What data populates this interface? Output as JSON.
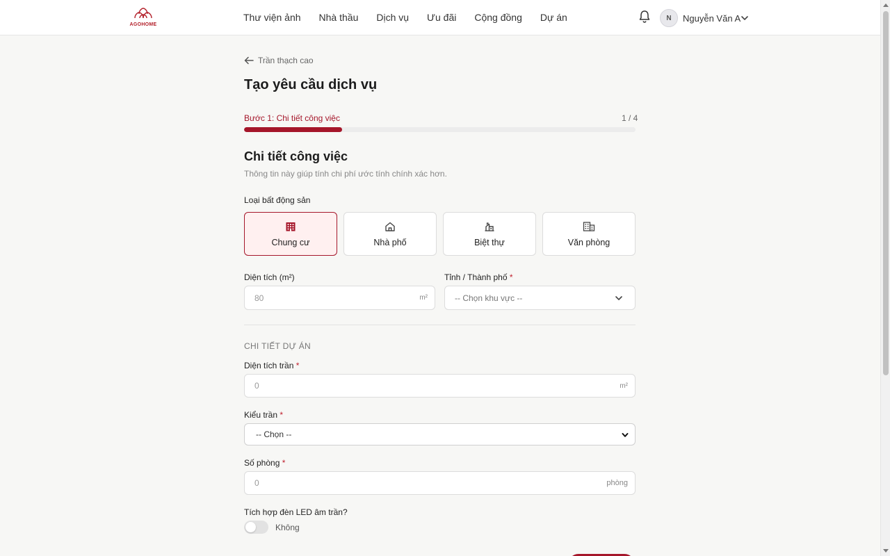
{
  "brand": {
    "name": "AGOHOME",
    "color": "#b3202a"
  },
  "nav": [
    "Thư viện ảnh",
    "Nhà thầu",
    "Dịch vụ",
    "Ưu đãi",
    "Cộng đồng",
    "Dự án"
  ],
  "user": {
    "initial": "N",
    "name": "Nguyễn Văn A"
  },
  "back_link": "Trần thạch cao",
  "page_title": "Tạo yêu cầu dịch vụ",
  "step": {
    "label": "Bước 1: Chi tiết công việc",
    "count": "1 / 4",
    "progress": 0.25
  },
  "section": {
    "title": "Chi tiết công việc",
    "subtitle": "Thông tin này giúp tính chi phí ước tính chính xác hơn."
  },
  "property_type": {
    "label": "Loại bất động sản",
    "options": [
      {
        "label": "Chung cư",
        "icon": "apartment-icon",
        "selected": true
      },
      {
        "label": "Nhà phố",
        "icon": "house-icon",
        "selected": false
      },
      {
        "label": "Biệt thự",
        "icon": "villa-icon",
        "selected": false
      },
      {
        "label": "Văn phòng",
        "icon": "office-icon",
        "selected": false
      }
    ]
  },
  "area": {
    "label": "Diện tích (m²)",
    "placeholder": "80",
    "unit": "m²"
  },
  "city": {
    "label": "Tỉnh / Thành phố",
    "required": "*",
    "placeholder": "-- Chọn khu vực --"
  },
  "project_details": {
    "heading": "CHI TIẾT DỰ ÁN",
    "ceiling_area": {
      "label": "Diện tích trần",
      "required": "*",
      "placeholder": "0",
      "unit": "m²"
    },
    "ceiling_type": {
      "label": "Kiểu trần",
      "required": "*",
      "selected": "-- Chọn --"
    },
    "rooms": {
      "label": "Số phòng",
      "required": "*",
      "placeholder": "0",
      "unit": "phòng"
    },
    "led": {
      "label": "Tích hợp đèn LED âm trần?",
      "value": "Không",
      "on": false
    }
  },
  "colors": {
    "accent": "#a5162a",
    "selected_bg": "#fff0f0"
  }
}
